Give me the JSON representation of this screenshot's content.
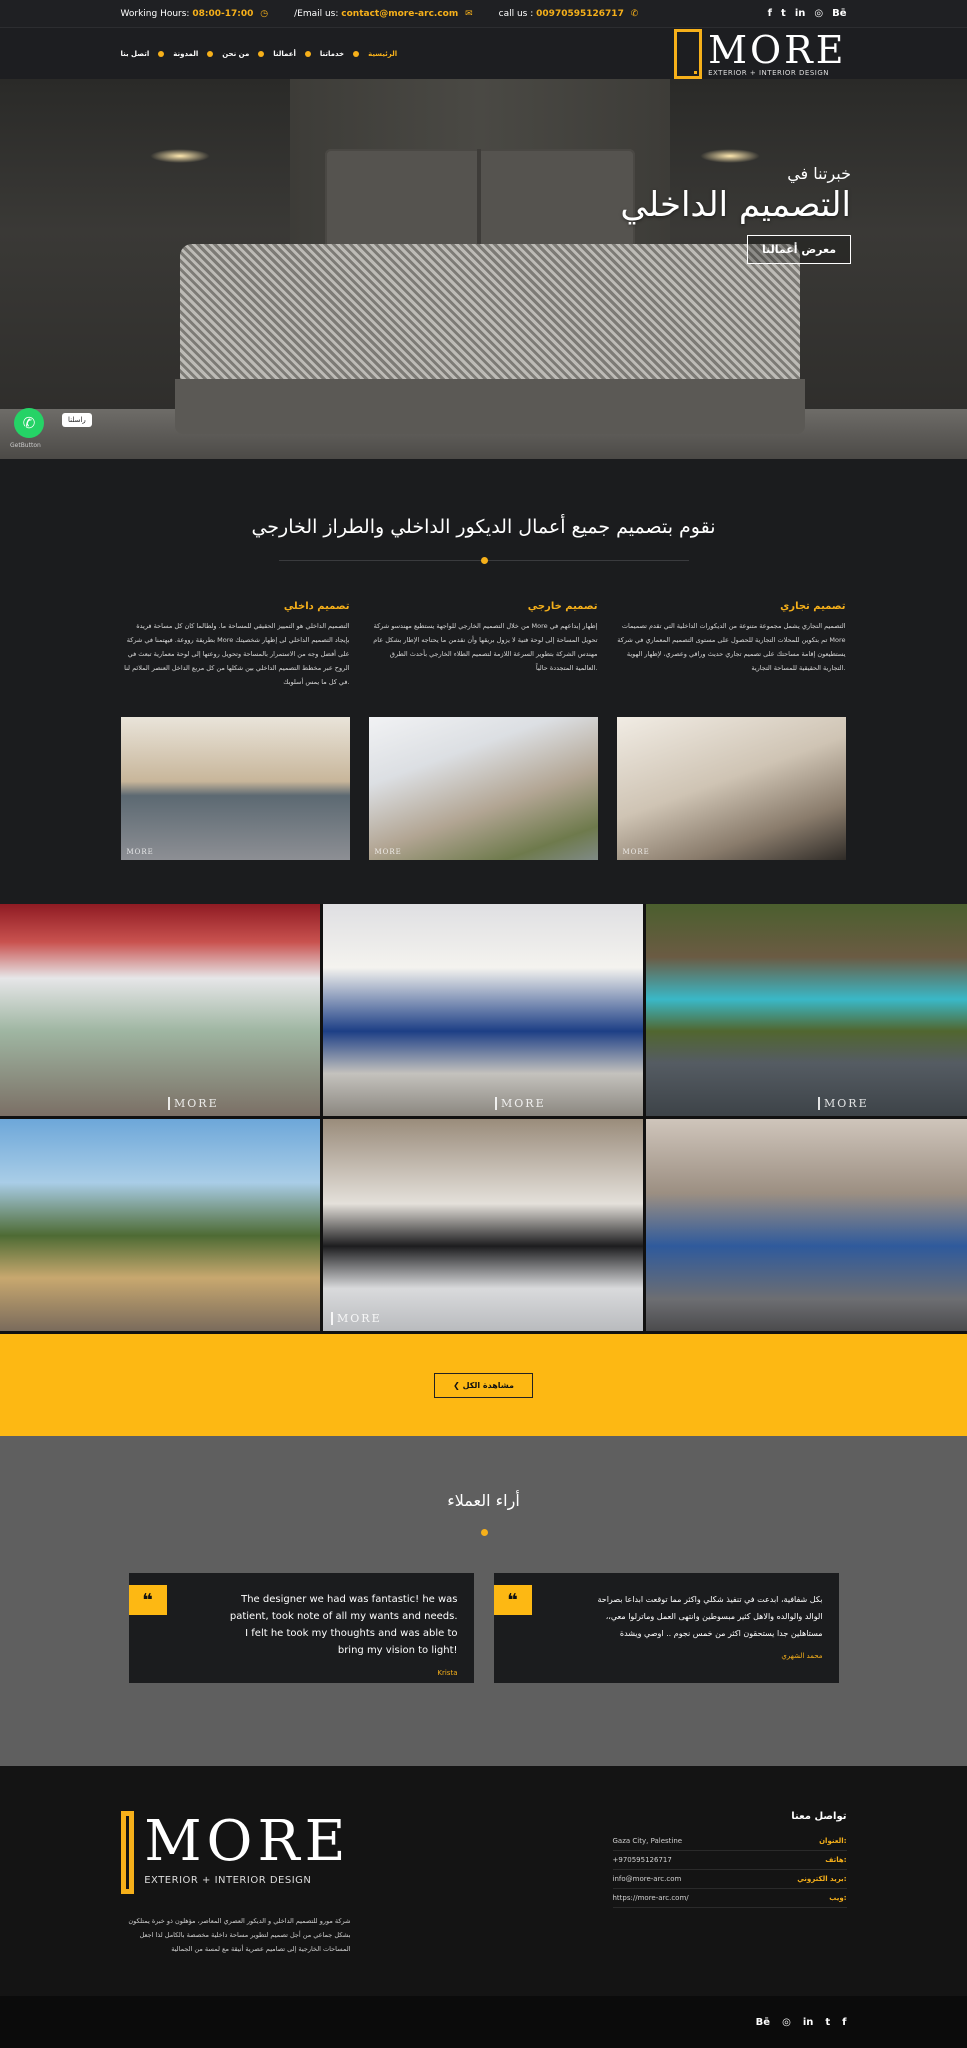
{
  "topbar": {
    "hours_label": "Working Hours:",
    "hours_value": "08:00-17:00",
    "email_label": "/Email us:",
    "email_value": "contact@more-arc.com",
    "call_label": "call us :",
    "call_value": "00970595126717",
    "social": [
      "f",
      "t",
      "in",
      "◎",
      "Bē"
    ]
  },
  "nav": {
    "items": [
      "الرئيسية",
      "خدماتنا",
      "أعمالنا",
      "من نحن",
      "المدونة",
      "اتصل بنا"
    ],
    "active_index": 0
  },
  "logo": {
    "word": "MORE",
    "tagline": "EXTERIOR + INTERIOR DESIGN"
  },
  "hero": {
    "subtitle": "خبرتنا في",
    "title": "التصميم الداخلي",
    "button": "معرض أعمالنا"
  },
  "whatsapp": {
    "label": "راسلنا",
    "credit": "GetButton"
  },
  "services": {
    "title": "نقوم بتصميم جميع أعمال الديكور الداخلي والطراز الخارجي",
    "items": [
      {
        "title": "تصميم داخلي",
        "text": "التصميم الداخلي هو التمييز الحقيقي للمساحة ما. ولطالما كان كل مساحة فريدة بطريقة رووعة. فيهتمنا في شركة More بإيجاد التصميم الداخلي لى إظهار شخصيتك على أفضل وجه من الاستمرار بالمساحة وتحويل روعتها إلى لوحة معمارية تبعث في الروح عبر مخطط التصميم الداخلي بين شكلها من كل مربع الداخل العنصر الملائم لنا في كل ما يمس أسلوبك."
      },
      {
        "title": "تصميم خارجي",
        "text": "من خلال التصميم الخارجي للواجهة يستطيع مهندسو شركة More إظهار إبداعهم في تحويل المساحة إلى لوحة فنية لا يزول بريقها وأن نقدمن ما يحتاجه الإطار بشكل عام مهندس الشركة بتطوير السرعة اللازمة لتصميم الطلاء الخارجي بأحدث الطرق العالمية المتجددة حالياً."
      },
      {
        "title": "تصميم تجاري",
        "text": "التصميم التجاري يشمل مجموعة متنوعة من الديكورات الداخلية التي تقدم تصميمات تم بتكوين للمحلات التجارية للحصول على مستوى التصميم المعماري في شركة More يستطيعون إقامة مساحتك على تصميم تجاري حديث وراقي وعصري، لإظهار الهوية التجارية الحقيقية للمساحة التجارية."
      }
    ]
  },
  "gallery": {
    "watermark": "MORE"
  },
  "cta": {
    "button": "مشاهدة الكل"
  },
  "testimonials": {
    "title": "أراء العملاء",
    "items": [
      {
        "text": "The designer we had was fantastic! he was patient, took note of all my wants and needs. I felt he took my thoughts and was able to bring my vision to light!",
        "author": "Krista"
      },
      {
        "text": "بكل شفافية، ابدعت في تنفيذ شكلي واكثر مما توقعت ابداعا بصراحة الوالد والوالده والاهل كثير مبسوطين وانتهى العمل وماترلوا معي،، مستاهلين جدا يستحقون اكثر من خمس نجوم .. اوصي ويشدة",
        "author": "محمد الشهري"
      }
    ]
  },
  "footer": {
    "about": "شركة مورو للتصميم الداخلي و الديكور العصري المعاصر، مؤهلون ذو خبرة يمتلكون بشكل جماعي من أجل تصميم لتطوير مساحة داخلية مخصصة بالكامل لذا اجعل المساحات الخارجية إلى تصاميم عصرية أنيقة مع لمسة من الجمالية",
    "contact_title": "تواصل معنا",
    "contact": [
      {
        "k": "العنوان:",
        "v": "Gaza City, Palestine"
      },
      {
        "k": "هاتف:",
        "v": "+970595126717"
      },
      {
        "k": "بريد الكتروني:",
        "v": "info@more-arc.com"
      },
      {
        "k": "ويب:",
        "v": "https://more-arc.com/"
      }
    ]
  },
  "bottom": {
    "social": [
      "Bē",
      "◎",
      "in",
      "t",
      "f"
    ]
  }
}
